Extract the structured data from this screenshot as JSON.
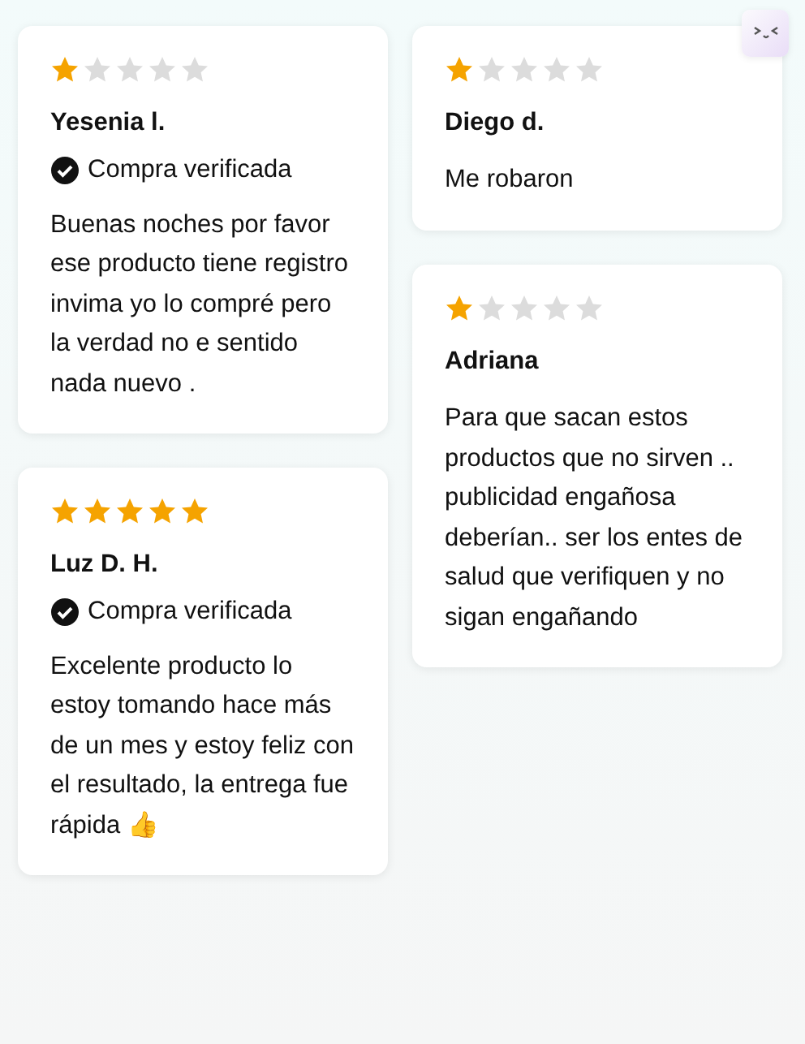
{
  "columns": [
    {
      "reviews": [
        {
          "stars": 1,
          "author": "Yesenia l.",
          "verified": true,
          "verified_label": "Compra verificada",
          "text": "Buenas noches por favor ese producto tiene registro invima yo lo compré pero la verdad no e sentido nada nuevo ."
        },
        {
          "stars": 5,
          "author": "Luz D. H.",
          "verified": true,
          "verified_label": "Compra verificada",
          "text": "Excelente producto lo estoy tomando hace más de un mes y estoy feliz con el resultado, la entrega fue rápida 👍"
        }
      ]
    },
    {
      "reviews": [
        {
          "stars": 1,
          "author": "Diego d.",
          "verified": false,
          "text": "Me robaron"
        },
        {
          "stars": 1,
          "author": "Adriana",
          "verified": false,
          "text": "Para que sacan estos productos que no sirven .. publicidad engañosa deberían.. ser los entes de salud que verifiquen y no sigan engañando"
        }
      ]
    }
  ]
}
